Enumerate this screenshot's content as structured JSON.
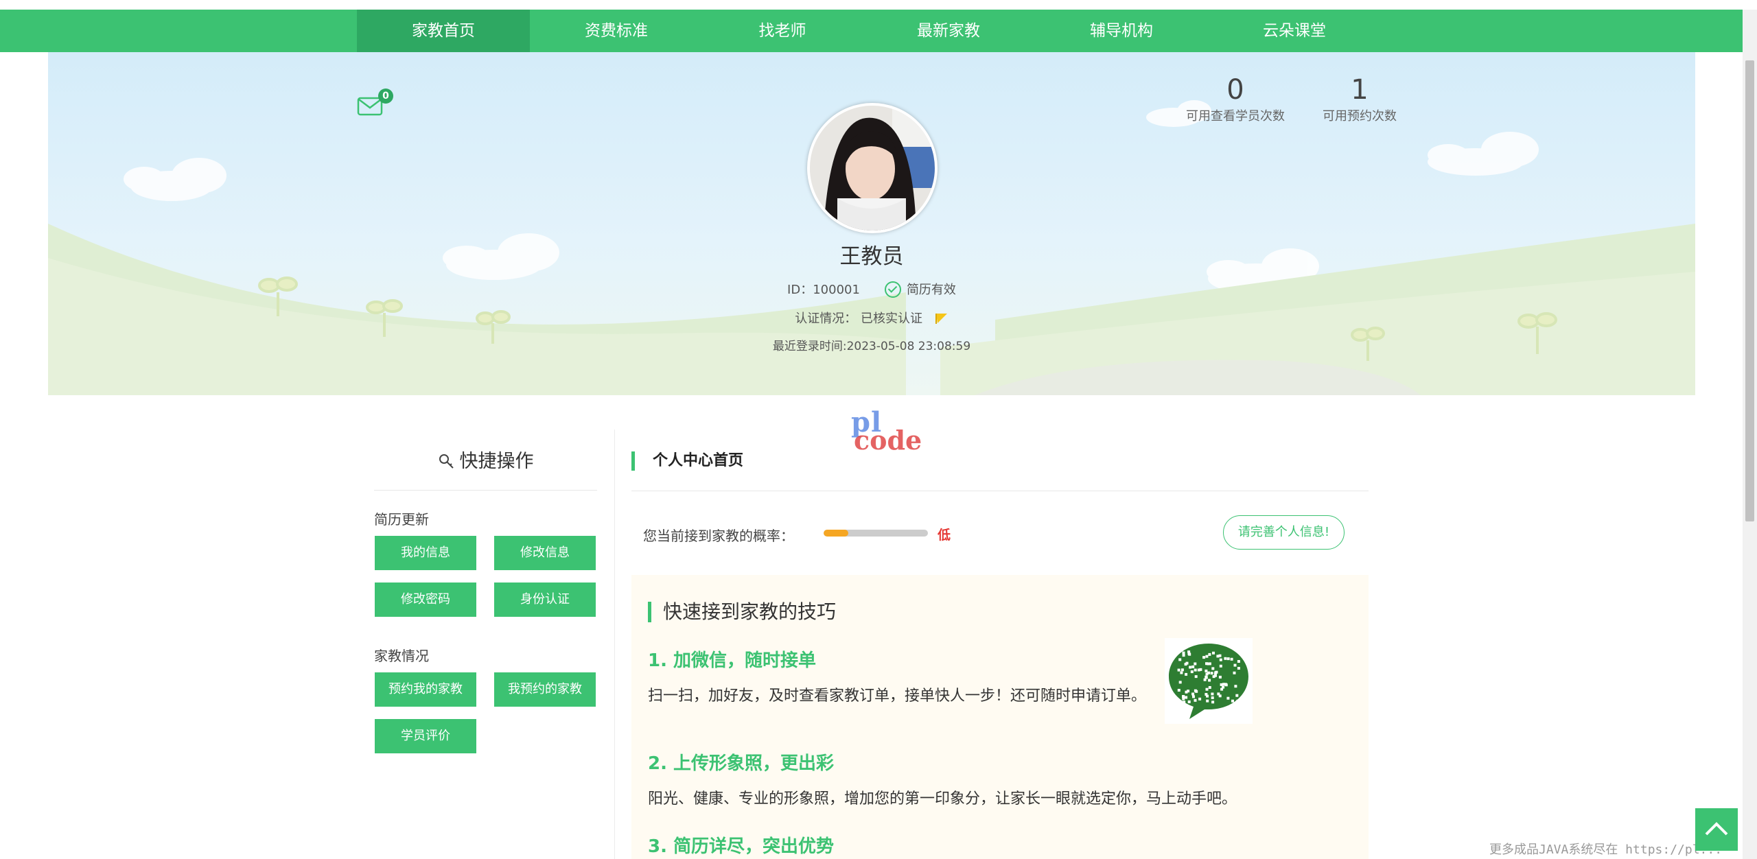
{
  "nav": {
    "items": [
      {
        "label": "家教首页",
        "active": true
      },
      {
        "label": "资费标准",
        "active": false
      },
      {
        "label": "找老师",
        "active": false
      },
      {
        "label": "最新家教",
        "active": false
      },
      {
        "label": "辅导机构",
        "active": false
      },
      {
        "label": "云朵课堂",
        "active": false
      }
    ]
  },
  "profile": {
    "mail_count": "0",
    "name": "王教员",
    "id_label": "ID：100001",
    "resume_status": "简历有效",
    "auth_label": "认证情况：",
    "auth_status": "已核实认证",
    "last_login": "最近登录时间:2023-05-08 23:08:59",
    "stats": [
      {
        "value": "0",
        "label": "可用查看学员次数"
      },
      {
        "value": "1",
        "label": "可用预约次数"
      }
    ]
  },
  "watermark": {
    "line1": "pl",
    "line2": "code"
  },
  "quick_ops": {
    "title": "快捷操作",
    "groups": [
      {
        "name": "简历更新",
        "buttons": [
          "我的信息",
          "修改信息",
          "修改密码",
          "身份认证"
        ]
      },
      {
        "name": "家教情况",
        "buttons": [
          "预约我的家教",
          "我预约的家教",
          "学员评价"
        ]
      }
    ]
  },
  "main": {
    "title": "个人中心首页",
    "probability_label": "您当前接到家教的概率：",
    "probability_level": "低",
    "probability_fraction": 0.24,
    "complete_button": "请完善个人信息!",
    "tips": {
      "title": "快速接到家教的技巧",
      "items": [
        {
          "heading": "1. 加微信，随时接单",
          "text": "扫一扫，加好友，及时查看家教订单，接单快人一步！还可随时申请订单。"
        },
        {
          "heading": "2. 上传形象照，更出彩",
          "text": "阳光、健康、专业的形象照，增加您的第一印象分，让家长一眼就选定你，马上动手吧。"
        },
        {
          "heading": "3. 简历详尽，突出优势",
          "text": ""
        }
      ]
    }
  },
  "footer_note": "更多成品JAVA系统尽在 https://pl...",
  "colors": {
    "brand": "#3cc272",
    "brand_dark": "#2ea862",
    "warning": "#e53935"
  }
}
